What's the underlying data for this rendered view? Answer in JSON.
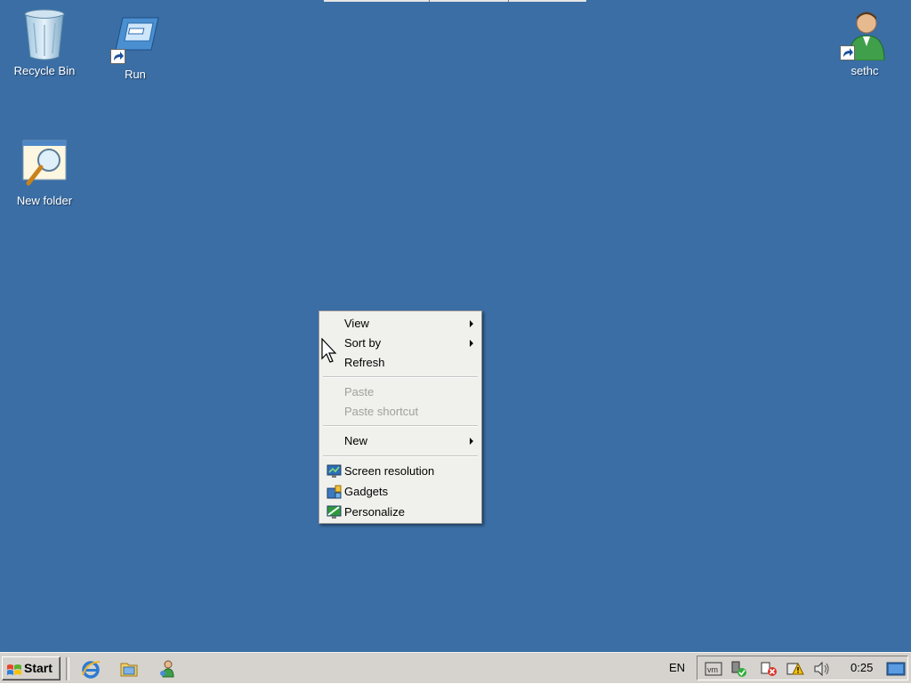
{
  "desktop": {
    "background_color": "#3a6ea5",
    "icons": [
      {
        "label": "Recycle Bin",
        "icon": "recycle-bin-icon"
      },
      {
        "label": "Run",
        "icon": "run-shortcut-icon"
      },
      {
        "label": "sethc",
        "icon": "user-shortcut-icon"
      },
      {
        "label": "New folder",
        "icon": "search-folder-icon"
      }
    ]
  },
  "context_menu": {
    "items": [
      {
        "label": "View",
        "submenu": true,
        "enabled": true
      },
      {
        "label": "Sort by",
        "submenu": true,
        "enabled": true
      },
      {
        "label": "Refresh",
        "submenu": false,
        "enabled": true
      },
      {
        "label": "Paste",
        "submenu": false,
        "enabled": false
      },
      {
        "label": "Paste shortcut",
        "submenu": false,
        "enabled": false
      },
      {
        "label": "New",
        "submenu": true,
        "enabled": true
      },
      {
        "label": "Screen resolution",
        "icon": "display-icon",
        "enabled": true
      },
      {
        "label": "Gadgets",
        "icon": "gadgets-icon",
        "enabled": true
      },
      {
        "label": "Personalize",
        "icon": "personalize-icon",
        "enabled": true
      }
    ]
  },
  "taskbar": {
    "start_label": "Start",
    "quick_launch": [
      "internet-explorer-icon",
      "explorer-folder-icon",
      "users-icon"
    ],
    "language": "EN",
    "tray_icons": [
      "vmware-tools-icon",
      "safely-remove-icon",
      "network-disconnected-icon",
      "action-center-warning-icon",
      "volume-icon"
    ],
    "clock": "0:25",
    "show_desktop": "show-desktop-icon"
  }
}
